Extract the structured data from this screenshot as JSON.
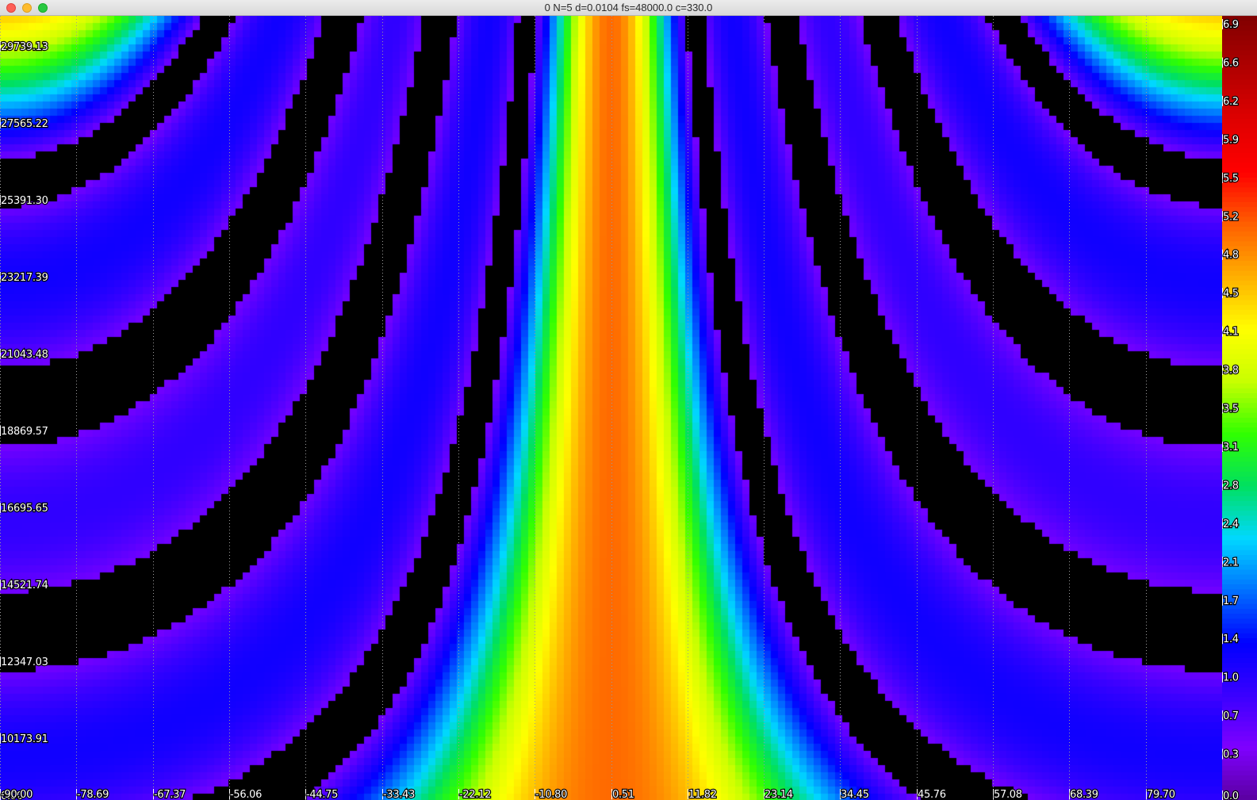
{
  "window": {
    "title": "0 N=5 d=0.0104 fs=48000.0 c=330.0"
  },
  "colors": {
    "background": "#000000",
    "gridline": "#9a9a9a",
    "colormap": [
      "#5a00a0",
      "#7f00ff",
      "#3a00ff",
      "#0000ff",
      "#0070ff",
      "#00d8ff",
      "#00e060",
      "#30ff00",
      "#c8ff00",
      "#ffff00",
      "#ffb000",
      "#ff6000",
      "#ff0000",
      "#e00000",
      "#b00000",
      "#800000"
    ]
  },
  "chart_data": {
    "type": "heatmap",
    "title": "",
    "xlabel": "",
    "ylabel": "",
    "x_ticks": [
      "-90.00",
      "-78.69",
      "-67.37",
      "-56.06",
      "-44.75",
      "-33.43",
      "-22.12",
      "-10.80",
      "0.51",
      "11.82",
      "23.14",
      "34.45",
      "45.76",
      "57.08",
      "68.39",
      "79.70"
    ],
    "xlim": [
      -90.0,
      90.0
    ],
    "y_ticks": [
      "0.00",
      "10173.91",
      "12347.03",
      "14521.74",
      "16695.65",
      "18869.57",
      "21043.48",
      "23217.39",
      "25391.30",
      "27565.22",
      "29739.13"
    ],
    "ylim": [
      8000,
      30000
    ],
    "colorbar_ticks": [
      "0.0",
      "0.3",
      "0.7",
      "1.0",
      "1.4",
      "1.7",
      "2.1",
      "2.4",
      "2.8",
      "3.1",
      "3.5",
      "3.8",
      "4.1",
      "4.5",
      "4.8",
      "5.2",
      "5.5",
      "5.9",
      "6.2",
      "6.6",
      "6.9"
    ],
    "colorbar_range": [
      0.0,
      6.9
    ],
    "grid": true,
    "colorbar_position": "right",
    "array": {
      "N": 5,
      "d": 0.0104,
      "fs": 48000.0,
      "c": 330.0
    }
  }
}
